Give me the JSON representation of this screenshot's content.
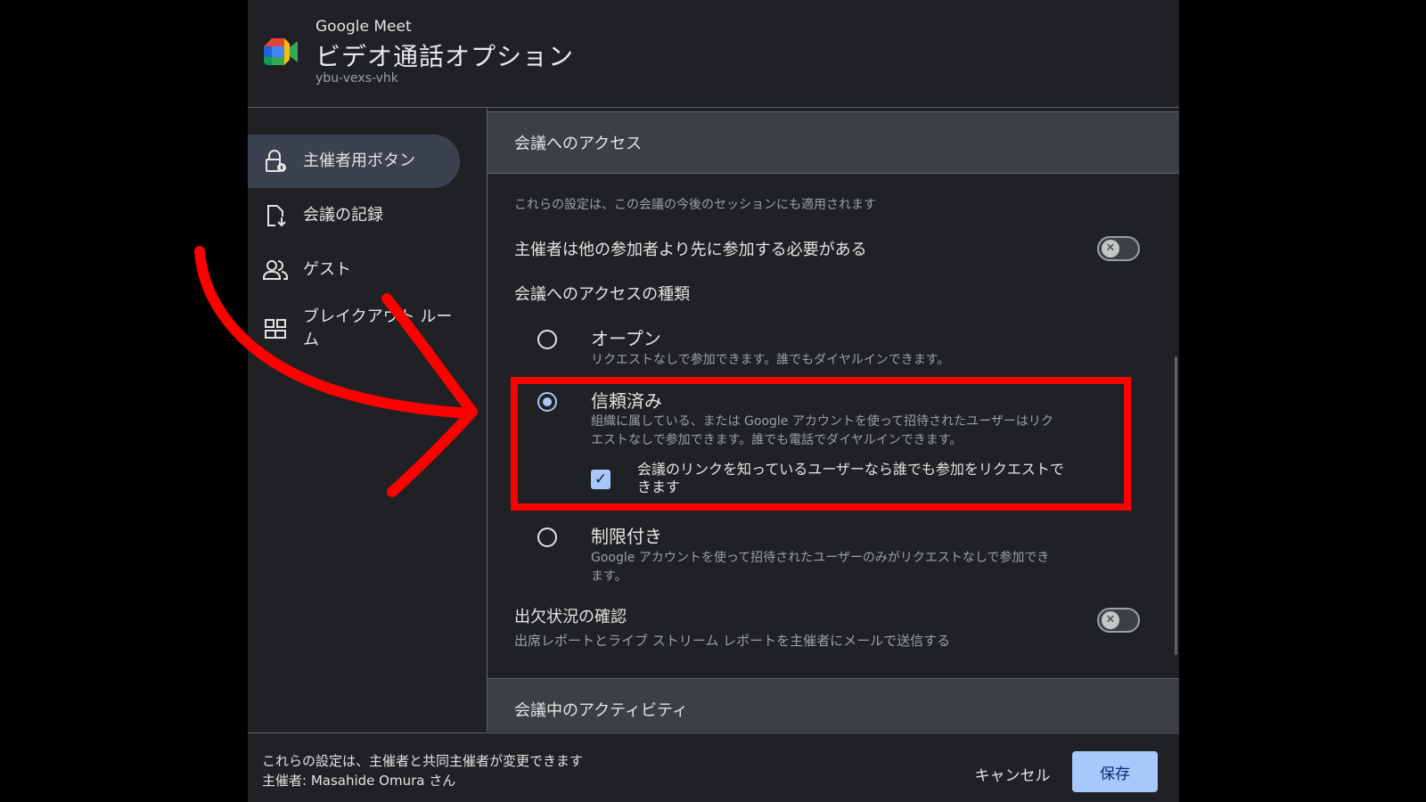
{
  "header": {
    "app_name": "Google Meet",
    "title": "ビデオ通話オプション",
    "meeting_code": "ybu-vexs-vhk"
  },
  "sidebar": {
    "items": [
      {
        "label": "主催者用ボタン",
        "icon": "lock-person-icon",
        "active": true
      },
      {
        "label": "会議の記録",
        "icon": "file-download-icon",
        "active": false
      },
      {
        "label": "ゲスト",
        "icon": "people-icon",
        "active": false
      },
      {
        "label": "ブレイクアウト ルーム",
        "icon": "grid-icon",
        "active": false
      }
    ]
  },
  "content": {
    "section_access": "会議へのアクセス",
    "note": "これらの設定は、この会議の今後のセッションにも適用されます",
    "host_join_first": {
      "label": "主催者は他の参加者より先に参加する必要がある",
      "enabled": false
    },
    "access_type_heading": "会議へのアクセスの種類",
    "options": [
      {
        "title": "オープン",
        "desc": "リクエストなしで参加できます。誰でもダイヤルインできます。",
        "selected": false
      },
      {
        "title": "信頼済み",
        "desc": "組織に属している、または Google アカウントを使って招待されたユーザーはリクエストなしで参加できます。誰でも電話でダイヤルインできます。",
        "selected": true
      },
      {
        "title": "制限付き",
        "desc": "Google アカウントを使って招待されたユーザーのみがリクエストなしで参加できます。",
        "selected": false
      }
    ],
    "link_request_checkbox": {
      "label": "会議のリンクを知っているユーザーなら誰でも参加をリクエストできます",
      "checked": true
    },
    "attendance": {
      "title": "出欠状況の確認",
      "desc": "出席レポートとライブ ストリーム レポートを主催者にメールで送信する",
      "enabled": false
    },
    "section_activity": "会議中のアクティビティ"
  },
  "footer": {
    "note_line1": "これらの設定は、主催者と共同主催者が変更できます",
    "note_line2": "主催者: Masahide Omura さん",
    "cancel_label": "キャンセル",
    "save_label": "保存"
  },
  "colors": {
    "annotation": "#ff0000",
    "accent": "#a8c7fa",
    "dialog_bg": "#202124"
  }
}
